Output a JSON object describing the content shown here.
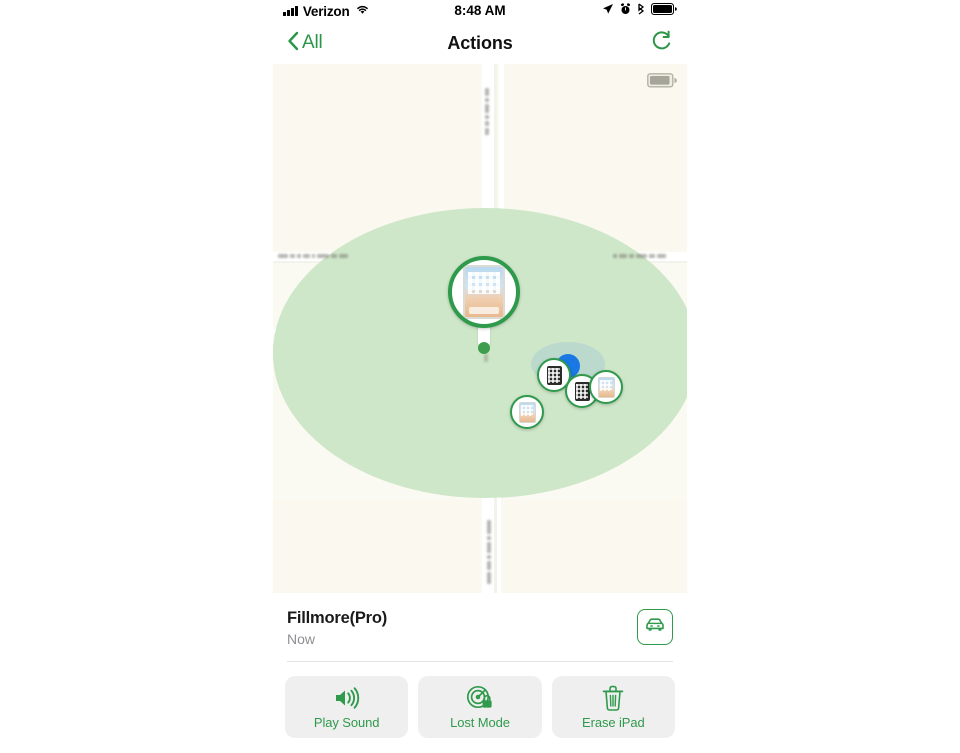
{
  "status_bar": {
    "carrier": "Verizon",
    "time": "8:48 AM",
    "signal_icon": "cellular-bars-icon",
    "wifi_icon": "wifi-icon",
    "location_icon": "location-arrow-icon",
    "alarm_icon": "alarm-clock-icon",
    "bluetooth_icon": "bluetooth-icon",
    "battery_icon": "battery-full-icon"
  },
  "nav_bar": {
    "back_label": "All",
    "back_icon": "chevron-left-icon",
    "title": "Actions",
    "refresh_icon": "refresh-icon"
  },
  "map": {
    "background_color": "#fbfaf2",
    "accuracy_circle_color": "#cfe7c9",
    "road_color": "#ffffff",
    "battery_widget_icon": "battery-icon",
    "pins": [
      {
        "name": "selected-device-pin",
        "device": "iPad",
        "icon": "ipad-home-screen-icon",
        "selected": true
      },
      {
        "name": "device-pin-2",
        "device": "iPad",
        "icon": "ipad-dark-icon",
        "selected": false
      },
      {
        "name": "device-pin-3",
        "device": "iPad",
        "icon": "ipad-dark-icon",
        "selected": false
      },
      {
        "name": "device-pin-4",
        "device": "iPad",
        "icon": "ipad-light-icon",
        "selected": false
      },
      {
        "name": "device-pin-5",
        "device": "iPhone",
        "icon": "iphone-light-icon",
        "selected": false
      }
    ],
    "user_location_icon": "blue-location-dot"
  },
  "device_info": {
    "name": "Fillmore(Pro)",
    "timestamp": "Now",
    "directions_icon": "car-icon"
  },
  "actions": [
    {
      "label": "Play Sound",
      "icon": "speaker-waves-icon",
      "name": "play-sound-button"
    },
    {
      "label": "Lost Mode",
      "icon": "radar-lock-icon",
      "name": "lost-mode-button"
    },
    {
      "label": "Erase iPad",
      "icon": "trash-icon",
      "name": "erase-ipad-button"
    }
  ],
  "colors": {
    "accent_green": "#2f9a4b",
    "button_fill": "#efeff0",
    "secondary_text": "#8e8e93"
  }
}
